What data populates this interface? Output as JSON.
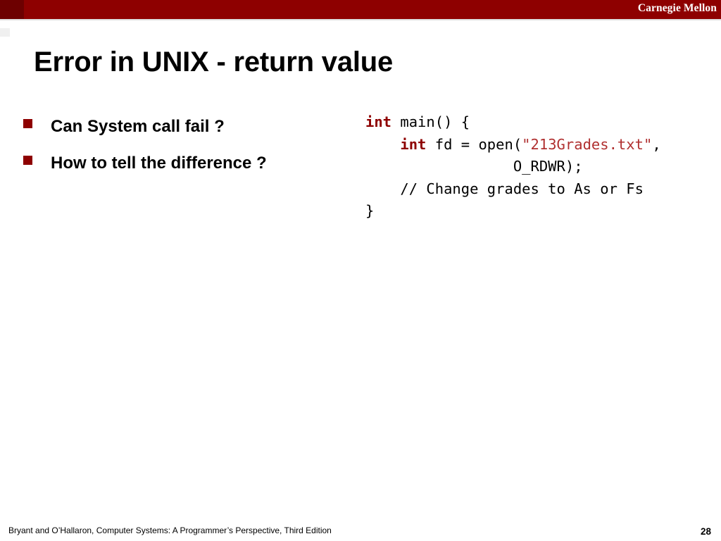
{
  "banner": {
    "title": "Carnegie Mellon",
    "bg_color": "#8e0000"
  },
  "slide": {
    "title": "Error in UNIX - return value",
    "bullets": [
      {
        "text": "Can System call fail ?"
      },
      {
        "text": "How to tell the difference ?"
      }
    ],
    "code": {
      "lines": [
        [
          {
            "t": "int",
            "c": "kw"
          },
          {
            "t": " main() {",
            "c": ""
          }
        ],
        [
          {
            "t": "    ",
            "c": ""
          },
          {
            "t": "int",
            "c": "kw"
          },
          {
            "t": " fd = open(",
            "c": ""
          },
          {
            "t": "\"213Grades.txt\"",
            "c": "str"
          },
          {
            "t": ",",
            "c": ""
          }
        ],
        [
          {
            "t": "                 O_RDWR);",
            "c": ""
          }
        ],
        [
          {
            "t": "    // Change grades to As or Fs",
            "c": ""
          }
        ],
        [
          {
            "t": "}",
            "c": ""
          }
        ]
      ]
    }
  },
  "footer": {
    "attribution": "Bryant and O’Hallaron, Computer Systems: A Programmer’s Perspective, Third Edition",
    "page_number": "28"
  }
}
